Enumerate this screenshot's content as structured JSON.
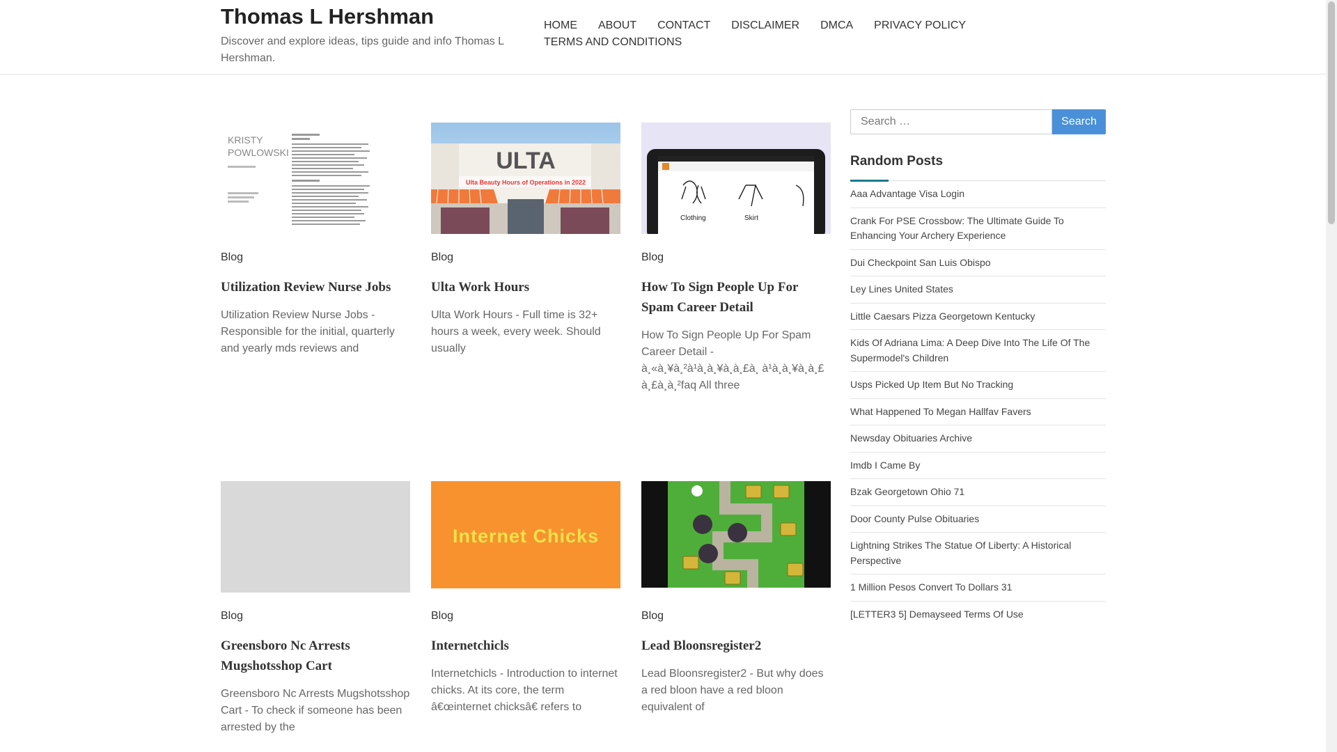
{
  "header": {
    "site_title": "Thomas L Hershman",
    "site_description": "Discover and explore ideas, tips guide and info Thomas L Hershman."
  },
  "nav": [
    {
      "label": "HOME"
    },
    {
      "label": "ABOUT"
    },
    {
      "label": "CONTACT"
    },
    {
      "label": "DISCLAIMER"
    },
    {
      "label": "DMCA"
    },
    {
      "label": "PRIVACY POLICY"
    },
    {
      "label": "TERMS AND CONDITIONS"
    }
  ],
  "posts": [
    {
      "category": "Blog",
      "title": "Utilization Review Nurse Jobs",
      "excerpt": "Utilization Review Nurse Jobs - Responsible for the initial, quarterly and yearly mds reviews and",
      "thumb_text_a": "KRISTY",
      "thumb_text_b": "POWLOWSKI"
    },
    {
      "category": "Blog",
      "title": "Ulta Work Hours",
      "excerpt": "Ulta Work Hours - Full time is 32+ hours a week, every week. Should usually",
      "thumb_text_a": "ULTA",
      "thumb_text_b": "Ulta Beauty Hours of Operations in 2022"
    },
    {
      "category": "Blog",
      "title": "How To Sign People Up For Spam Career Detail",
      "excerpt": "How To Sign People Up For Spam Career Detail - à¸«à¸¥à¸²à¹à¸à¸¥à¸à¸£à¸ à¹à¸à¸¥à¸à¸£ à¸£à¸à¸²faq All three",
      "thumb_text_a": "Clothing",
      "thumb_text_b": "Skirt"
    },
    {
      "category": "Blog",
      "title": "Greensboro Nc Arrests Mugshotsshop Cart",
      "excerpt": "Greensboro Nc Arrests Mugshotsshop Cart - To check if someone has been arrested by the"
    },
    {
      "category": "Blog",
      "title": "Internetchicls",
      "excerpt": "Internetchicls - Introduction to internet chicks. At its core, the term â€œinternet chicksâ€  refers to",
      "thumb_text_a": "Internet Chicks"
    },
    {
      "category": "Blog",
      "title": "Lead Bloonsregister2",
      "excerpt": "Lead Bloonsregister2 - But why does a red bloon have a red bloon equivalent of"
    }
  ],
  "sidebar": {
    "search_placeholder": "Search …",
    "search_button": "Search",
    "random_title": "Random Posts",
    "random_posts": [
      "Aaa Advantage Visa Login",
      "Crank For PSE Crossbow: The Ultimate Guide To Enhancing Your Archery Experience",
      "Dui Checkpoint San Luis Obispo",
      "Ley Lines United States",
      "Little Caesars Pizza Georgetown Kentucky",
      "Kids Of Adriana Lima: A Deep Dive Into The Life Of The Supermodel's Children",
      "Usps Picked Up Item But No Tracking",
      "What Happened To Megan Hallfav Favers",
      "Newsday Obituaries Archive",
      "Imdb I Came By",
      "Bzak Georgetown Ohio 71",
      "Door County Pulse Obituaries",
      "Lightning Strikes The Statue Of Liberty: A Historical Perspective",
      "1 Million Pesos Convert To Dollars 31",
      "[LETTER3 5] Demayseed Terms Of Use"
    ]
  },
  "colors": {
    "search_button": "#4a90d9",
    "widget_accent": "#1a7a8a",
    "ulta_orange": "#f07a3c",
    "internet_chicks_bg": "#f7922f"
  }
}
